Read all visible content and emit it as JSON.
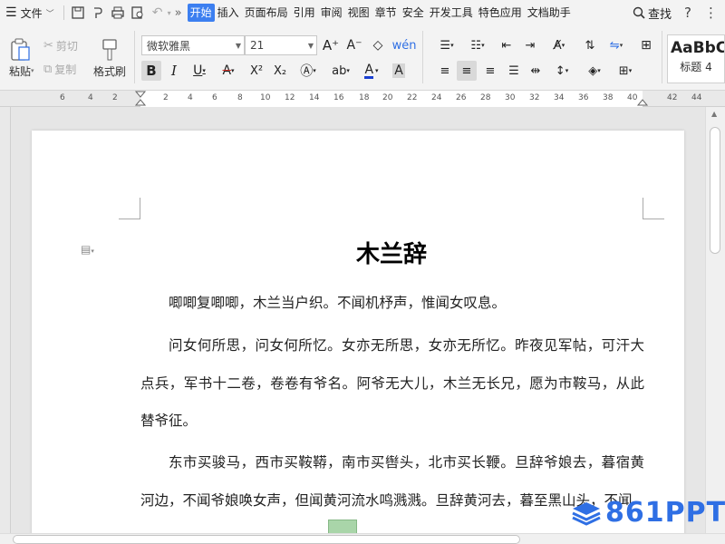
{
  "menubar": {
    "file_label": "文件",
    "tabs": [
      "开始",
      "插入",
      "页面布局",
      "引用",
      "审阅",
      "视图",
      "章节",
      "安全",
      "开发工具",
      "特色应用",
      "文档助手"
    ],
    "active_tab_index": 0,
    "search_label": "查找"
  },
  "ribbon": {
    "paste_label": "粘贴",
    "cut_label": "剪切",
    "copy_label": "复制",
    "format_painter_label": "格式刷",
    "font_name": "微软雅黑",
    "font_size": "21",
    "style_preview": "AaBbC",
    "style_name": "标题 4"
  },
  "ruler": {
    "left_numbers": [
      "6",
      "4",
      "2"
    ],
    "numbers": [
      "2",
      "4",
      "6",
      "8",
      "10",
      "12",
      "14",
      "16",
      "18",
      "20",
      "22",
      "24",
      "26",
      "28",
      "30",
      "32",
      "34",
      "36",
      "38",
      "40"
    ],
    "right_numbers": [
      "42",
      "44"
    ]
  },
  "document": {
    "title": "木兰辞",
    "paragraphs": [
      "唧唧复唧唧，木兰当户织。不闻机杼声，惟闻女叹息。",
      "问女何所思，问女何所忆。女亦无所思，女亦无所忆。昨夜见军帖，可汗大点兵，军书十二卷，卷卷有爷名。阿爷无大儿，木兰无长兄，愿为市鞍马，从此替爷征。",
      "东市买骏马，西市买鞍鞯，南市买辔头，北市买长鞭。旦辞爷娘去，暮宿黄河边，不闻爷娘唤女声，但闻黄河流水鸣溅溅。旦辞黄河去，暮至黑山头，不闻"
    ]
  },
  "watermark": {
    "text": "861PPT"
  },
  "colors": {
    "accent": "#3c7ff0",
    "watermark": "#2f6fe4",
    "font_color_red": "#d9342b",
    "font_color_blue": "#1a3fd1"
  }
}
